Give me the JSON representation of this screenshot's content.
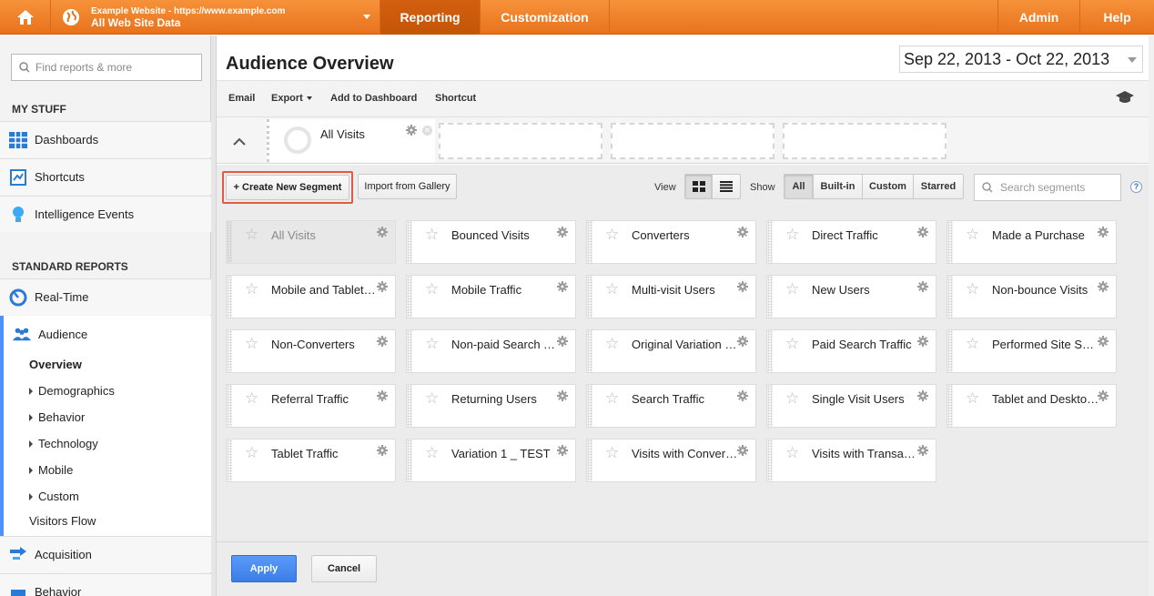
{
  "topbar": {
    "site_name": "Example Website - https://www.example.com",
    "view_name": "All Web Site Data",
    "tabs": [
      {
        "label": "Reporting",
        "active": true
      },
      {
        "label": "Customization",
        "active": false
      }
    ],
    "admin_label": "Admin",
    "help_label": "Help",
    "colors": {
      "bar": "#f08a2e",
      "active_tab": "#cc5a0c"
    }
  },
  "sidebar": {
    "search_placeholder": "Find reports & more",
    "my_stuff_heading": "MY STUFF",
    "my_stuff": [
      {
        "label": "Dashboards",
        "icon": "dashboard-grid-icon"
      },
      {
        "label": "Shortcuts",
        "icon": "shortcut-icon"
      },
      {
        "label": "Intelligence Events",
        "icon": "lightbulb-icon"
      }
    ],
    "standard_heading": "STANDARD REPORTS",
    "realtime_label": "Real-Time",
    "audience_label": "Audience",
    "audience_children": [
      {
        "label": "Overview",
        "active": true,
        "expandable": false
      },
      {
        "label": "Demographics",
        "expandable": true
      },
      {
        "label": "Behavior",
        "expandable": true
      },
      {
        "label": "Technology",
        "expandable": true
      },
      {
        "label": "Mobile",
        "expandable": true
      },
      {
        "label": "Custom",
        "expandable": true
      },
      {
        "label": "Visitors Flow",
        "expandable": false
      }
    ],
    "acquisition_label": "Acquisition",
    "behavior_label": "Behavior"
  },
  "main": {
    "title": "Audience Overview",
    "date_range": "Sep 22, 2013 - Oct 22, 2013",
    "toolbar": {
      "email": "Email",
      "export": "Export",
      "add_to_dashboard": "Add to Dashboard",
      "shortcut": "Shortcut"
    },
    "active_segment": "All Visits",
    "controls": {
      "create_new_segment": "+ Create New Segment",
      "import_from_gallery": "Import from Gallery",
      "view_label": "View",
      "show_label": "Show",
      "show_options": [
        {
          "label": "All",
          "active": true
        },
        {
          "label": "Built-in",
          "active": false
        },
        {
          "label": "Custom",
          "active": false
        },
        {
          "label": "Starred",
          "active": false
        }
      ],
      "search_placeholder": "Search segments",
      "help": "?"
    },
    "segments": [
      "All Visits",
      "Bounced Visits",
      "Converters",
      "Direct Traffic",
      "Made a Purchase",
      "Mobile and Tablet Traffic",
      "Mobile Traffic",
      "Multi-visit Users",
      "New Users",
      "Non-bounce Visits",
      "Non-Converters",
      "Non-paid Search Traffic",
      "Original Variation Visits",
      "Paid Search Traffic",
      "Performed Site Search",
      "Referral Traffic",
      "Returning Users",
      "Search Traffic",
      "Single Visit Users",
      "Tablet and Desktop Traffic",
      "Tablet Traffic",
      "Variation 1 _ TEST",
      "Visits with Conversions",
      "Visits with Transactions"
    ],
    "disabled_segment": "All Visits",
    "apply_label": "Apply",
    "cancel_label": "Cancel",
    "colors": {
      "apply": "#4a8af4",
      "highlight": "#e05b45"
    }
  }
}
